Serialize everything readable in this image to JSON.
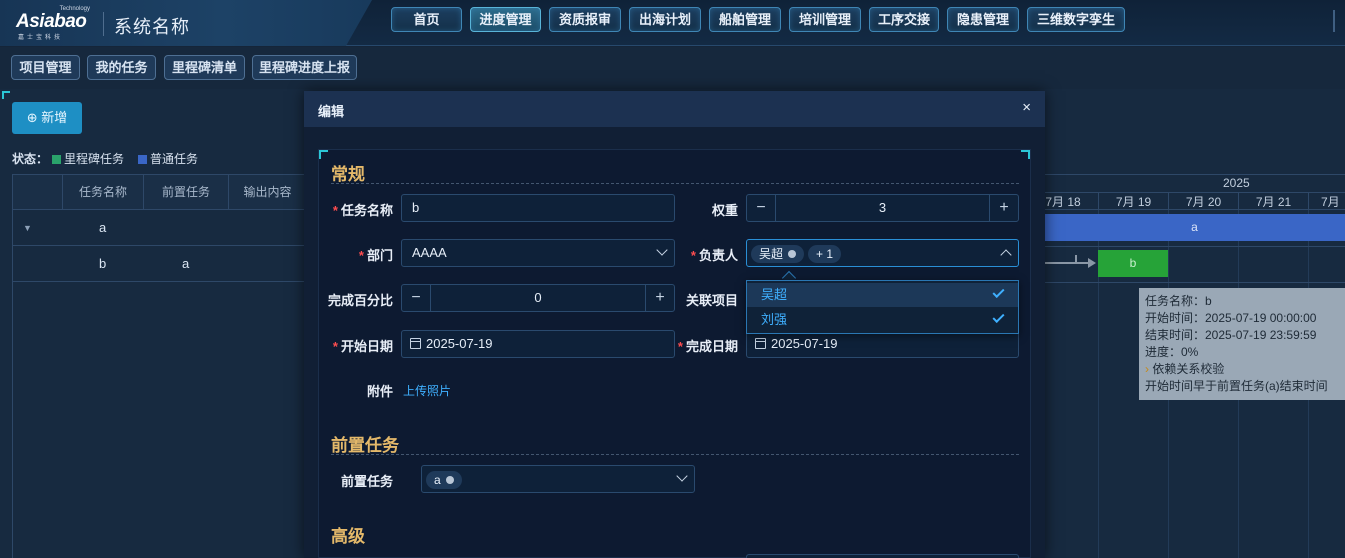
{
  "header": {
    "logo_text": "Asiabao",
    "logo_tech": "Technology",
    "logo_sub": "嘉士宝科技",
    "system_title": "系统名称",
    "nav": [
      {
        "label": "首页"
      },
      {
        "label": "进度管理"
      },
      {
        "label": "资质报审"
      },
      {
        "label": "出海计划"
      },
      {
        "label": "船舶管理"
      },
      {
        "label": "培训管理"
      },
      {
        "label": "工序交接"
      },
      {
        "label": "隐患管理"
      },
      {
        "label": "三维数字孪生"
      }
    ]
  },
  "subnav": [
    {
      "label": "项目管理"
    },
    {
      "label": "我的任务"
    },
    {
      "label": "里程碑清单"
    },
    {
      "label": "里程碑进度上报"
    }
  ],
  "toolbar": {
    "add_label": "⊕ 新增"
  },
  "status": {
    "label": "状态：",
    "items": [
      {
        "label": "里程碑任务",
        "color": "#2aa36b"
      },
      {
        "label": "普通任务",
        "color": "#3a66c6"
      }
    ]
  },
  "grid": {
    "columns": [
      "任务名称",
      "前置任务",
      "输出内容"
    ],
    "rows": [
      {
        "name": "a",
        "pre": ""
      },
      {
        "name": "b",
        "pre": "a"
      }
    ]
  },
  "gantt": {
    "year": "2025",
    "days": [
      "7月 18",
      "7月 19",
      "7月 20",
      "7月 21",
      "7月"
    ],
    "bars": [
      {
        "label": "a",
        "color": "#3a66c6"
      },
      {
        "label": "b",
        "color": "#26a338"
      }
    ]
  },
  "tooltip": {
    "lines": [
      "任务名称：b",
      "开始时间：2025-07-19 00:00:00",
      "结束时间：2025-07-19 23:59:59",
      "进度：0%"
    ],
    "warn_title": "依赖关系校验",
    "warn_msg": "开始时间早于前置任务(a)结束时间"
  },
  "modal": {
    "title": "编辑",
    "close": "×",
    "sections": {
      "general": "常规",
      "predecessor": "前置任务",
      "advanced": "高级"
    },
    "fields": {
      "task_name_label": "任务名称",
      "task_name_value": "b",
      "weight_label": "权重",
      "weight_value": "3",
      "dept_label": "部门",
      "dept_value": "AAAA",
      "owner_label": "负责人",
      "owner_tag": "吴超",
      "owner_more": "+ 1",
      "percent_label": "完成百分比",
      "percent_value": "0",
      "project_label": "关联项目",
      "start_label": "开始日期",
      "start_value": "2025-07-19",
      "end_label": "完成日期",
      "end_value": "2025-07-19",
      "attach_label": "附件",
      "upload_label": "上传照片",
      "pre_label": "前置任务",
      "pre_tag": "a"
    },
    "owner_options": [
      "吴超",
      "刘强"
    ]
  }
}
